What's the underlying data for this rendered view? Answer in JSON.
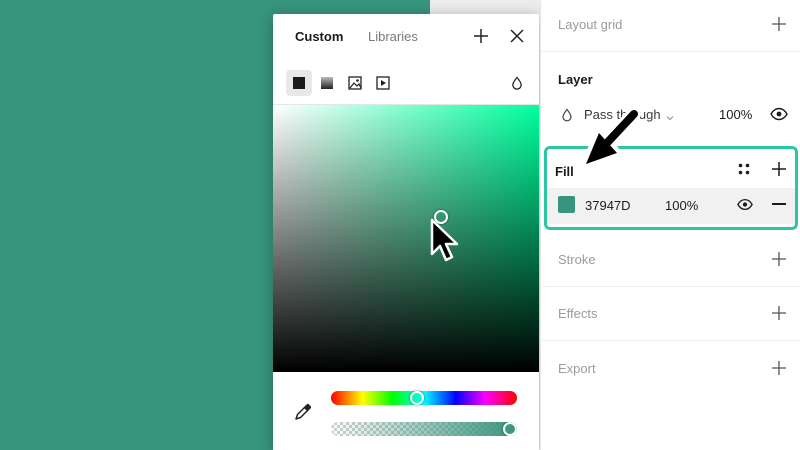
{
  "colors": {
    "fill": "#37947D",
    "highlight": "#2ec5a5",
    "hue_pure": "#00ff9d"
  },
  "picker": {
    "tabs": [
      {
        "label": "Custom",
        "active": true
      },
      {
        "label": "Libraries",
        "active": false
      }
    ],
    "add_icon": "plus-icon",
    "close_icon": "close-icon",
    "fill_types": [
      {
        "icon": "solid-fill-icon",
        "active": true
      },
      {
        "icon": "gradient-fill-icon",
        "active": false
      },
      {
        "icon": "image-fill-icon",
        "active": false
      },
      {
        "icon": "video-fill-icon",
        "active": false
      }
    ],
    "blend_icon": "drop-icon",
    "saturation": 0.63,
    "brightness": 0.58,
    "hue_position": 0.46,
    "alpha_position": 1.0
  },
  "panel": {
    "layout_grid": {
      "title": "Layout grid"
    },
    "layer": {
      "title": "Layer",
      "blend_mode": "Pass through",
      "opacity": "100%"
    },
    "fill": {
      "title": "Fill",
      "hex": "37947D",
      "opacity": "100%"
    },
    "stroke": {
      "title": "Stroke"
    },
    "effects": {
      "title": "Effects"
    },
    "export": {
      "title": "Export"
    }
  }
}
